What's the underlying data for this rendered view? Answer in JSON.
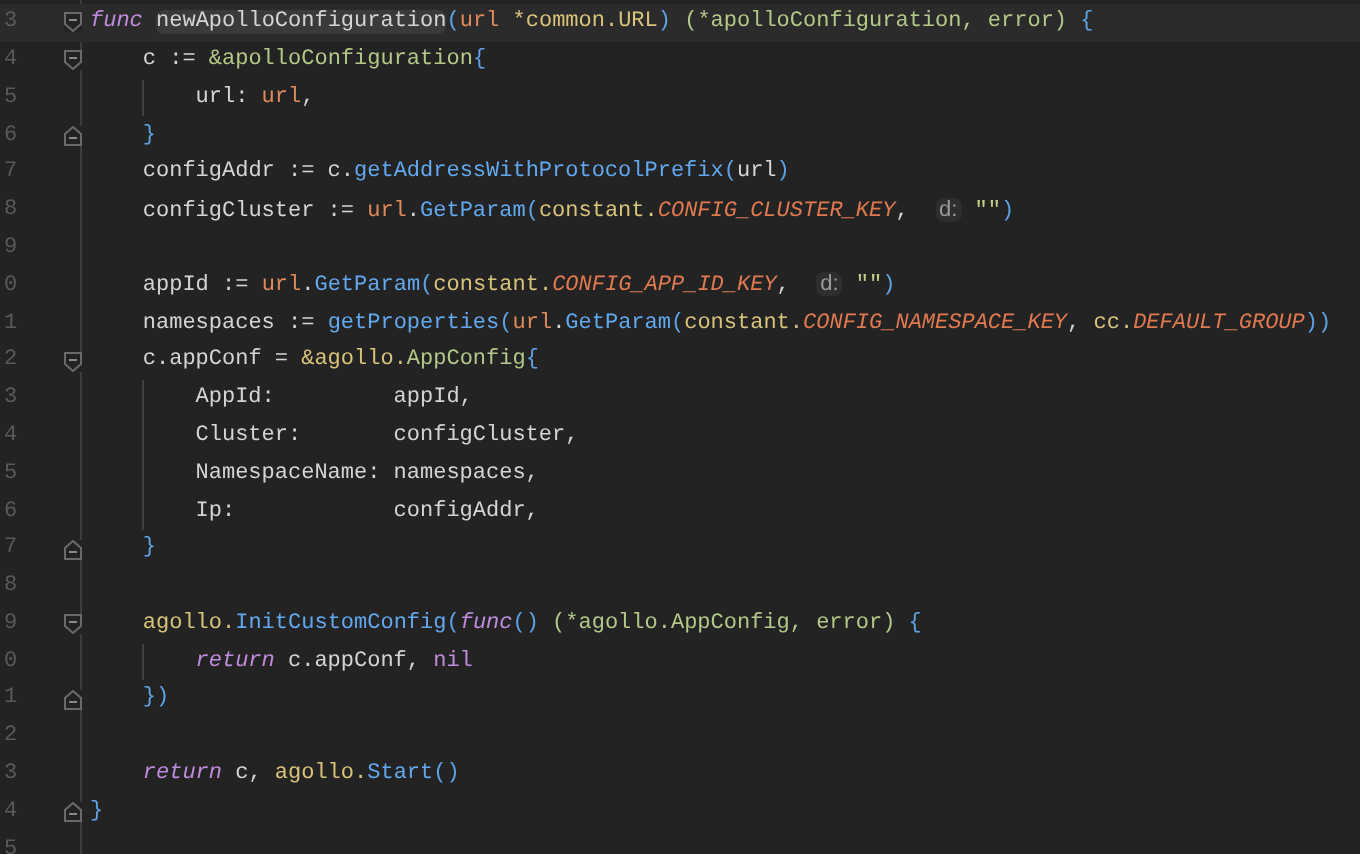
{
  "editor": {
    "lines": [
      {
        "number": "3",
        "kind": "code",
        "current": true,
        "tokens": [
          {
            "kind": "kw",
            "text": "func "
          },
          {
            "kind": "plain",
            "text": "newApolloConfiguration",
            "highlighted": true
          },
          {
            "kind": "bracket",
            "text": "("
          },
          {
            "kind": "param",
            "text": "url"
          },
          {
            "kind": "pkg",
            "text": " *common.URL"
          },
          {
            "kind": "bracket",
            "text": ")"
          },
          {
            "kind": "type",
            "text": " (*apolloConfiguration, error)"
          },
          {
            "kind": "bracket",
            "text": " {"
          }
        ],
        "children": [
          {
            "number": "4",
            "kind": "code",
            "current": false,
            "tokens": [
              {
                "kind": "plain",
                "text": "c := "
              },
              {
                "kind": "type",
                "text": "&apolloConfiguration"
              },
              {
                "kind": "bracket",
                "text": "{"
              }
            ],
            "children": [
              {
                "number": "5",
                "kind": "code",
                "current": false,
                "tokens": [
                  {
                    "kind": "plain",
                    "text": "url: "
                  },
                  {
                    "kind": "param",
                    "text": "url"
                  },
                  {
                    "kind": "plain",
                    "text": ","
                  }
                ]
              }
            ]
          },
          {
            "number": "6",
            "kind": "closer",
            "current": false,
            "tokens": [
              {
                "kind": "bracket",
                "text": "}"
              }
            ]
          },
          {
            "number": "7",
            "kind": "code",
            "current": false,
            "tokens": [
              {
                "kind": "plain",
                "text": "configAddr := c."
              },
              {
                "kind": "fn",
                "text": "getAddressWithProtocolPrefix"
              },
              {
                "kind": "bracket",
                "text": "("
              },
              {
                "kind": "plain",
                "text": "url"
              },
              {
                "kind": "bracket",
                "text": ")"
              }
            ]
          },
          {
            "number": "8",
            "kind": "code",
            "current": false,
            "tokens": [
              {
                "kind": "plain",
                "text": "configCluster := "
              },
              {
                "kind": "param",
                "text": "url"
              },
              {
                "kind": "plain",
                "text": "."
              },
              {
                "kind": "fn",
                "text": "GetParam"
              },
              {
                "kind": "bracket",
                "text": "("
              },
              {
                "kind": "pkg",
                "text": "constant."
              },
              {
                "kind": "const",
                "text": "CONFIG_CLUSTER_KEY"
              },
              {
                "kind": "plain",
                "text": ",  "
              },
              {
                "kind": "hint",
                "text": "d:"
              },
              {
                "kind": "string",
                "text": " \"\""
              },
              {
                "kind": "bracket",
                "text": ")"
              }
            ]
          },
          {
            "number": "9",
            "kind": "blank",
            "current": false
          },
          {
            "number": "0",
            "kind": "code",
            "current": false,
            "tokens": [
              {
                "kind": "plain",
                "text": "appId := "
              },
              {
                "kind": "param",
                "text": "url"
              },
              {
                "kind": "plain",
                "text": "."
              },
              {
                "kind": "fn",
                "text": "GetParam"
              },
              {
                "kind": "bracket",
                "text": "("
              },
              {
                "kind": "pkg",
                "text": "constant."
              },
              {
                "kind": "const",
                "text": "CONFIG_APP_ID_KEY"
              },
              {
                "kind": "plain",
                "text": ",  "
              },
              {
                "kind": "hint",
                "text": "d:"
              },
              {
                "kind": "string",
                "text": " \"\""
              },
              {
                "kind": "bracket",
                "text": ")"
              }
            ]
          },
          {
            "number": "1",
            "kind": "code",
            "current": false,
            "tokens": [
              {
                "kind": "plain",
                "text": "namespaces := "
              },
              {
                "kind": "fn",
                "text": "getProperties"
              },
              {
                "kind": "bracket",
                "text": "("
              },
              {
                "kind": "param",
                "text": "url"
              },
              {
                "kind": "plain",
                "text": "."
              },
              {
                "kind": "fn",
                "text": "GetParam"
              },
              {
                "kind": "bracket",
                "text": "("
              },
              {
                "kind": "pkg",
                "text": "constant."
              },
              {
                "kind": "const",
                "text": "CONFIG_NAMESPACE_KEY"
              },
              {
                "kind": "plain",
                "text": ", "
              },
              {
                "kind": "pkg",
                "text": "cc."
              },
              {
                "kind": "const",
                "text": "DEFAULT_GROUP"
              },
              {
                "kind": "bracket",
                "text": "))"
              }
            ]
          },
          {
            "number": "2",
            "kind": "code",
            "current": false,
            "tokens": [
              {
                "kind": "plain",
                "text": "c.appConf = "
              },
              {
                "kind": "pkg",
                "text": "&agollo."
              },
              {
                "kind": "type",
                "text": "AppConfig"
              },
              {
                "kind": "bracket",
                "text": "{"
              }
            ],
            "children": [
              {
                "number": "3",
                "kind": "code",
                "current": false,
                "tokens": [
                  {
                    "kind": "plain",
                    "text": "AppId:         appId,"
                  }
                ]
              },
              {
                "number": "4",
                "kind": "code",
                "current": false,
                "tokens": [
                  {
                    "kind": "plain",
                    "text": "Cluster:       configCluster,"
                  }
                ]
              },
              {
                "number": "5",
                "kind": "code",
                "current": false,
                "tokens": [
                  {
                    "kind": "plain",
                    "text": "NamespaceName: namespaces,"
                  }
                ]
              },
              {
                "number": "6",
                "kind": "code",
                "current": false,
                "tokens": [
                  {
                    "kind": "plain",
                    "text": "Ip:            configAddr,"
                  }
                ]
              }
            ]
          },
          {
            "number": "7",
            "kind": "closer",
            "current": false,
            "tokens": [
              {
                "kind": "bracket",
                "text": "}"
              }
            ]
          },
          {
            "number": "8",
            "kind": "blank",
            "current": false
          },
          {
            "number": "9",
            "kind": "code",
            "current": false,
            "tokens": [
              {
                "kind": "pkg",
                "text": "agollo."
              },
              {
                "kind": "fn",
                "text": "InitCustomConfig"
              },
              {
                "kind": "bracket",
                "text": "("
              },
              {
                "kind": "kw",
                "text": "func"
              },
              {
                "kind": "bracket",
                "text": "()"
              },
              {
                "kind": "type",
                "text": " (*agollo.AppConfig, error)"
              },
              {
                "kind": "bracket",
                "text": " {"
              }
            ],
            "children": [
              {
                "number": "0",
                "kind": "code",
                "current": false,
                "tokens": [
                  {
                    "kind": "kw",
                    "text": "return"
                  },
                  {
                    "kind": "plain",
                    "text": " c.appConf, "
                  },
                  {
                    "kind": "nil",
                    "text": "nil"
                  }
                ]
              }
            ]
          },
          {
            "number": "1",
            "kind": "closer",
            "current": false,
            "tokens": [
              {
                "kind": "bracket",
                "text": "})"
              }
            ]
          },
          {
            "number": "2",
            "kind": "blank",
            "current": false
          },
          {
            "number": "3",
            "kind": "code",
            "current": false,
            "tokens": [
              {
                "kind": "kw",
                "text": "return"
              },
              {
                "kind": "plain",
                "text": " c, "
              },
              {
                "kind": "pkg",
                "text": "agollo."
              },
              {
                "kind": "fn",
                "text": "Start"
              },
              {
                "kind": "bracket",
                "text": "()"
              }
            ]
          }
        ]
      },
      {
        "number": "4",
        "kind": "closer",
        "current": false,
        "tokens": [
          {
            "kind": "bracket",
            "text": "}"
          }
        ]
      },
      {
        "number": "5",
        "kind": "blank",
        "current": false
      }
    ]
  }
}
